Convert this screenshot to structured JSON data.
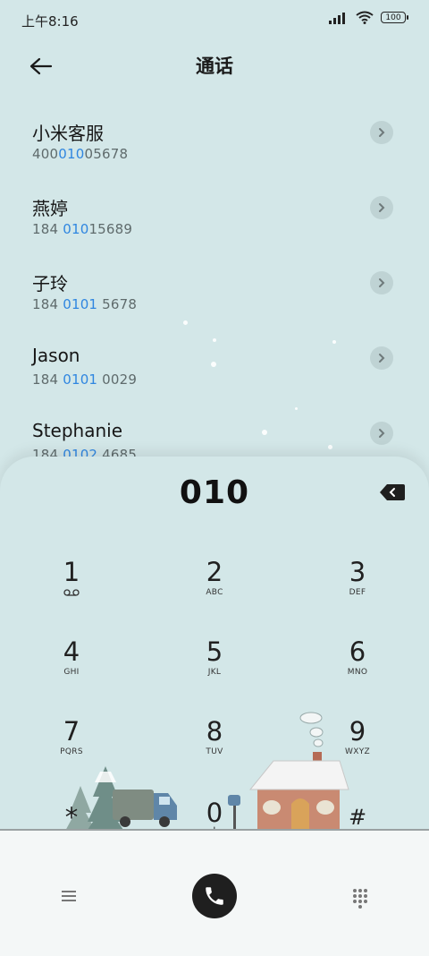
{
  "status": {
    "time": "上午8:16",
    "battery": "100"
  },
  "header": {
    "title": "通话"
  },
  "contacts": [
    {
      "name": "小米客服",
      "number_parts": [
        "400",
        "010",
        "05678"
      ]
    },
    {
      "name": "燕婷",
      "number_parts": [
        "184 ",
        "010",
        "15689"
      ]
    },
    {
      "name": "子玲",
      "number_parts": [
        "184 ",
        "0101",
        " 5678"
      ]
    },
    {
      "name": "Jason",
      "number_parts": [
        "184 ",
        "0101",
        " 0029"
      ]
    },
    {
      "name": "Stephanie",
      "number_parts": [
        "184 ",
        "0102",
        " 4685"
      ]
    }
  ],
  "dialer": {
    "number": "010",
    "keys": [
      {
        "digit": "1",
        "letters": ""
      },
      {
        "digit": "2",
        "letters": "ABC"
      },
      {
        "digit": "3",
        "letters": "DEF"
      },
      {
        "digit": "4",
        "letters": "GHI"
      },
      {
        "digit": "5",
        "letters": "JKL"
      },
      {
        "digit": "6",
        "letters": "MNO"
      },
      {
        "digit": "7",
        "letters": "PQRS"
      },
      {
        "digit": "8",
        "letters": "TUV"
      },
      {
        "digit": "9",
        "letters": "WXYZ"
      },
      {
        "digit": "*",
        "letters": ","
      },
      {
        "digit": "0",
        "letters": "+"
      },
      {
        "digit": "#",
        "letters": ""
      }
    ]
  },
  "icons": {
    "back": "arrow-left-icon",
    "detail": "chevron-right-icon",
    "backspace": "backspace-icon",
    "voicemail": "voicemail-icon",
    "menu": "menu-icon",
    "call": "phone-icon",
    "dialpad": "dialpad-icon"
  },
  "colors": {
    "background": "#d3e7e8",
    "highlight": "#2f86e0",
    "call_button": "#1f1f1f"
  }
}
